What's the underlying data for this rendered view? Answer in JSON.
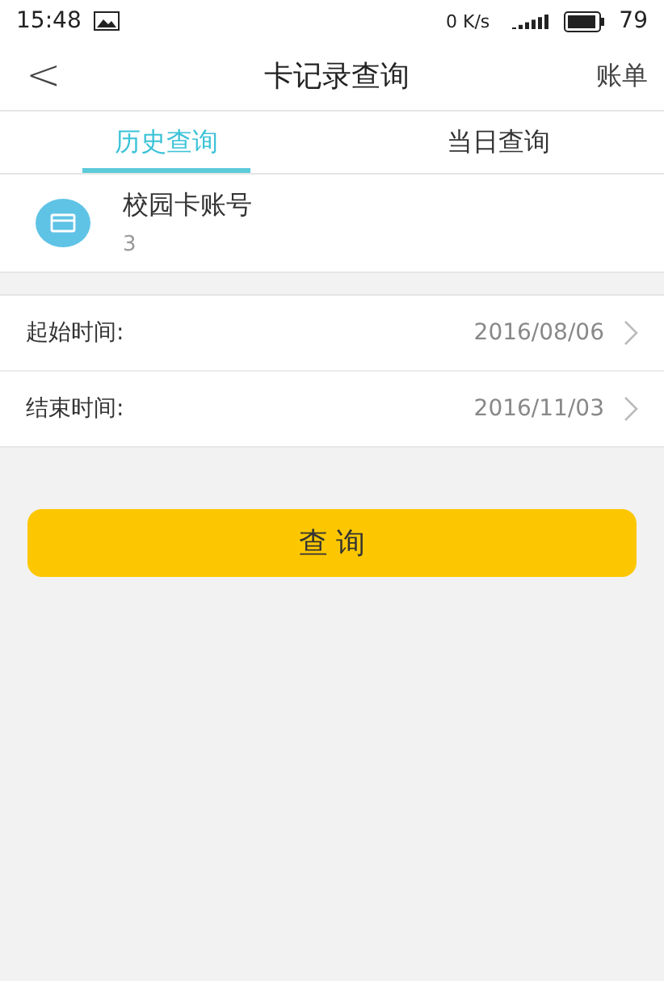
{
  "status_bar": {
    "time": "15:48",
    "speed": "0 K/s",
    "battery": "79"
  },
  "nav": {
    "back": "<",
    "title": "卡记录查询",
    "action": "账单"
  },
  "tabs": [
    {
      "label": "历史查询",
      "selected": true
    },
    {
      "label": "当日查询",
      "selected": false
    }
  ],
  "account": {
    "label": "校园卡账号",
    "value": "3"
  },
  "date_rows": [
    {
      "label": "起始时间:",
      "value": "2016/08/06"
    },
    {
      "label": "结束时间:",
      "value": "2016/11/03"
    }
  ],
  "query_button": "查 询"
}
